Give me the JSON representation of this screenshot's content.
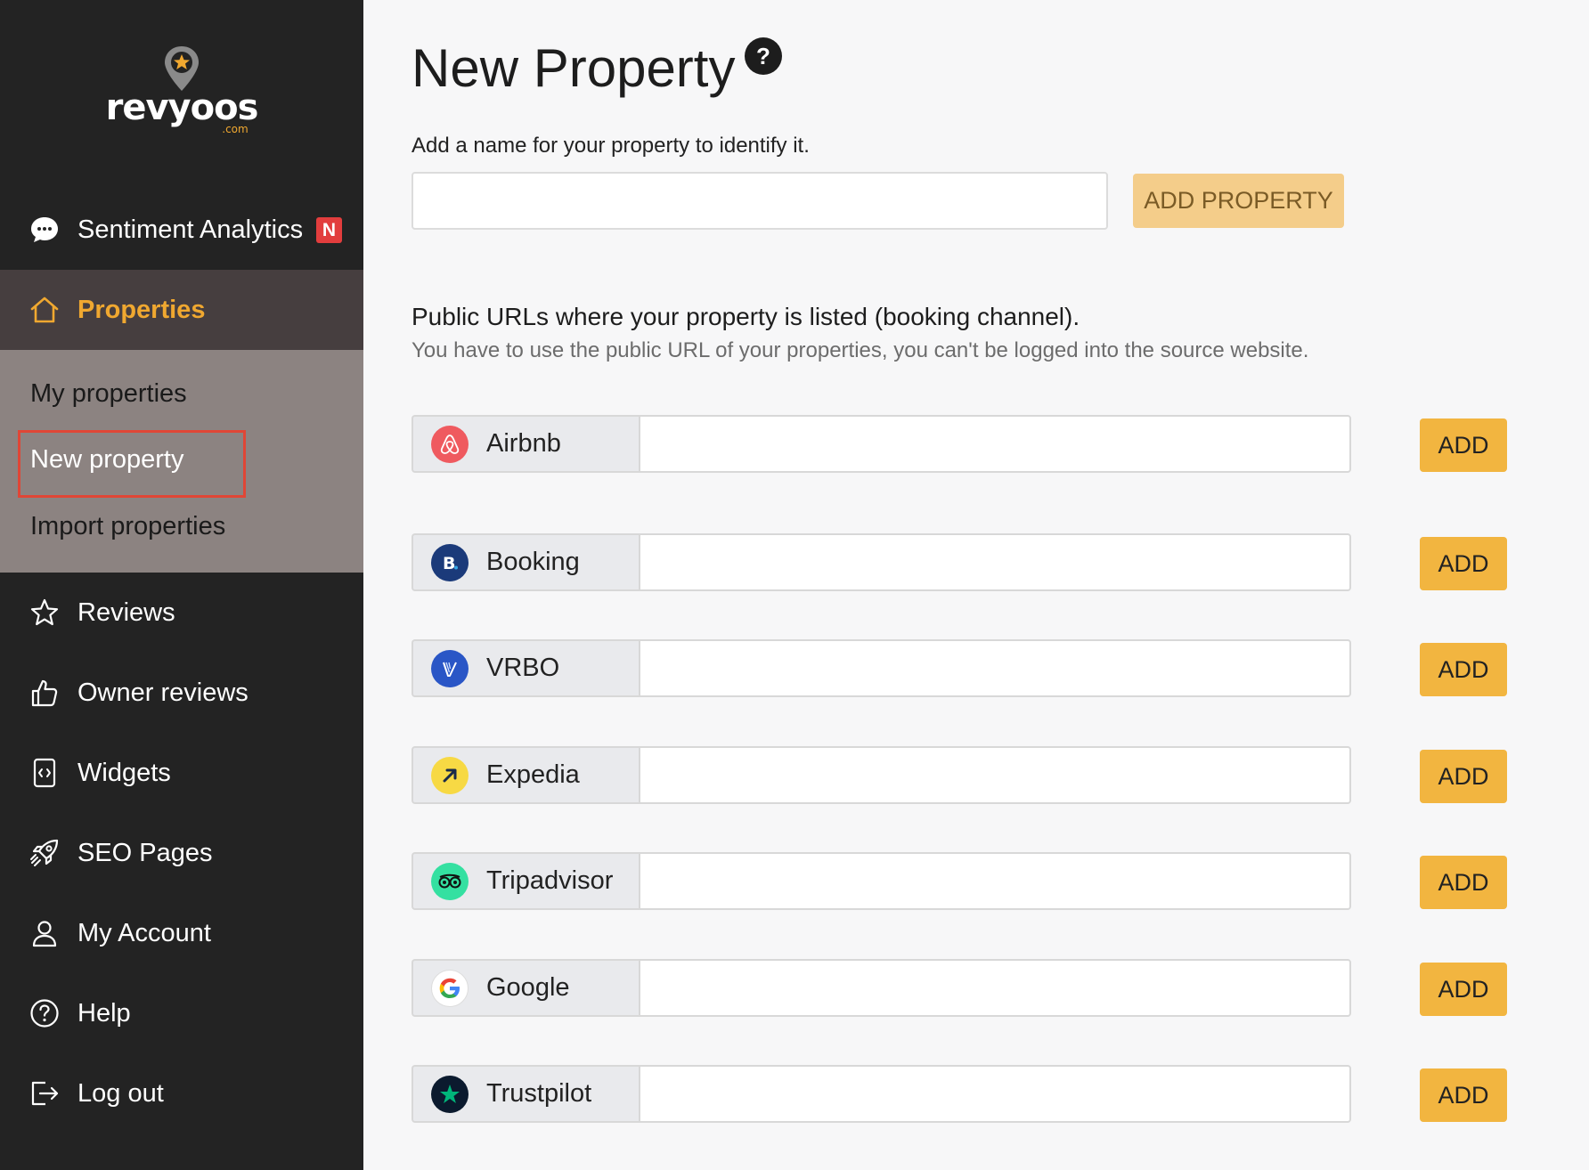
{
  "brand": {
    "name": "revyoos",
    "suffix": ".com",
    "accent": "#f0a830"
  },
  "sidebar": {
    "sentiment": {
      "label": "Sentiment Analytics",
      "badge": "N",
      "icon": "chat-bubble-icon"
    },
    "properties": {
      "label": "Properties",
      "icon": "home-icon",
      "active": true
    },
    "sub": {
      "my": "My properties",
      "new": "New property",
      "import": "Import properties"
    },
    "items": [
      {
        "label": "Reviews",
        "icon": "star-icon"
      },
      {
        "label": "Owner reviews",
        "icon": "thumbs-up-icon"
      },
      {
        "label": "Widgets",
        "icon": "code-file-icon"
      },
      {
        "label": "SEO Pages",
        "icon": "rocket-icon"
      },
      {
        "label": "My Account",
        "icon": "user-icon"
      },
      {
        "label": "Help",
        "icon": "help-circle-icon"
      },
      {
        "label": "Log out",
        "icon": "logout-icon"
      }
    ]
  },
  "main": {
    "title": "New Property",
    "help_glyph": "?",
    "name_hint": "Add a name for your property to identify it.",
    "name_value": "",
    "add_property_label": "ADD PROPERTY",
    "urls_title": "Public URLs where your property is listed (booking channel).",
    "urls_subtitle": "You have to use the public URL of your properties, you can't be logged into the source website.",
    "add_label": "ADD",
    "channels": [
      {
        "name": "Airbnb",
        "value": ""
      },
      {
        "name": "Booking",
        "value": ""
      },
      {
        "name": "VRBO",
        "value": ""
      },
      {
        "name": "Expedia",
        "value": ""
      },
      {
        "name": "Tripadvisor",
        "value": ""
      },
      {
        "name": "Google",
        "value": ""
      },
      {
        "name": "Trustpilot",
        "value": ""
      }
    ]
  }
}
